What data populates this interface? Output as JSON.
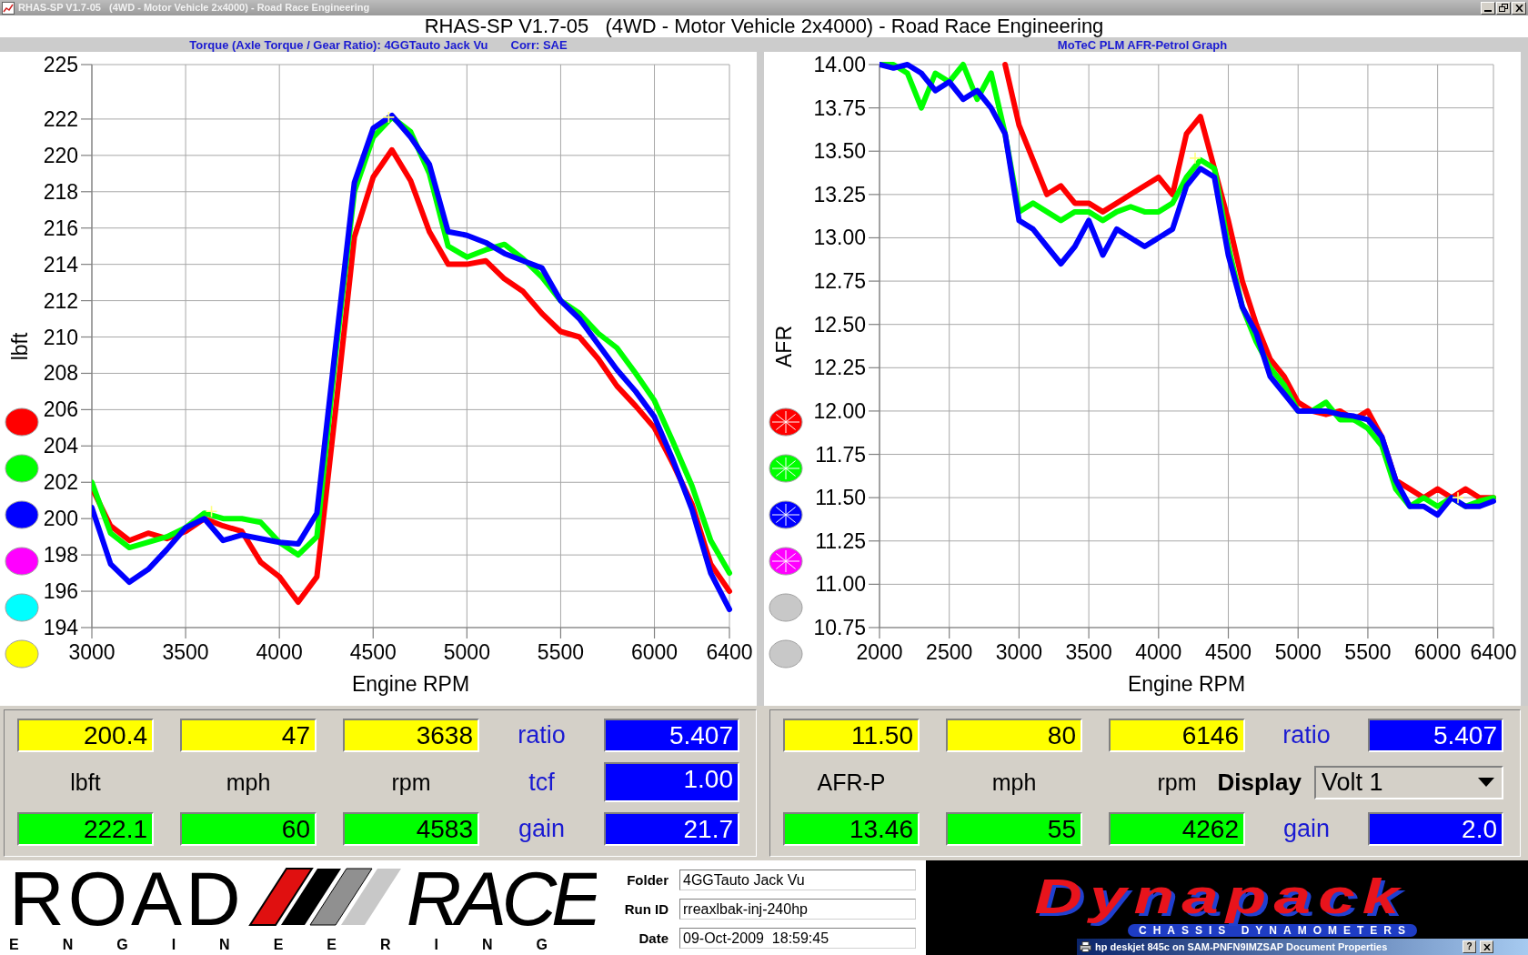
{
  "window": {
    "title": "RHAS-SP V1.7-05   (4WD - Motor Vehicle 2x4000) - Road Race Engineering"
  },
  "header": {
    "title": "RHAS-SP V1.7-05   (4WD - Motor Vehicle 2x4000) - Road Race Engineering"
  },
  "charts": [
    {
      "headings": [
        "Torque (Axle Torque / Gear Ratio): 4GGTauto Jack Vu",
        "Corr: SAE"
      ],
      "legend": [
        {
          "color": "#ff0000",
          "kind": "plain"
        },
        {
          "color": "#00ff00",
          "kind": "plain"
        },
        {
          "color": "#0000ff",
          "kind": "plain"
        },
        {
          "color": "#ff00ff",
          "kind": "plain"
        },
        {
          "color": "#00ffff",
          "kind": "plain"
        },
        {
          "color": "#ffff00",
          "kind": "plain"
        }
      ],
      "chart_data": {
        "type": "line",
        "xlabel": "Engine RPM",
        "ylabel": "lbft",
        "x": [
          3000,
          3100,
          3200,
          3300,
          3400,
          3500,
          3600,
          3700,
          3800,
          3900,
          4000,
          4100,
          4200,
          4300,
          4400,
          4500,
          4600,
          4700,
          4800,
          4900,
          5000,
          5100,
          5200,
          5300,
          5400,
          5500,
          5600,
          5700,
          5800,
          5900,
          6000,
          6100,
          6200,
          6300,
          6400
        ],
        "series": [
          {
            "color": "#ff0000",
            "values": [
              201.7,
              199.6,
              198.8,
              199.2,
              198.9,
              199.3,
              200.0,
              199.6,
              199.3,
              197.6,
              196.8,
              195.4,
              196.8,
              206.0,
              215.5,
              218.8,
              220.3,
              218.6,
              215.8,
              214.0,
              214.0,
              214.2,
              213.2,
              212.5,
              211.3,
              210.3,
              210.0,
              208.8,
              207.3,
              206.2,
              205.0,
              203.0,
              200.8,
              197.5,
              196.0
            ]
          },
          {
            "color": "#00ff00",
            "values": [
              202.0,
              199.2,
              198.4,
              198.7,
              199.0,
              199.5,
              200.3,
              200.0,
              200.0,
              199.8,
              198.7,
              198.0,
              199.0,
              209.0,
              218.0,
              221.0,
              222.1,
              221.3,
              219.0,
              215.0,
              214.4,
              214.8,
              215.1,
              214.3,
              213.3,
              212.0,
              211.3,
              210.2,
              209.4,
              208.0,
              206.5,
              204.2,
              201.8,
              198.8,
              197.0
            ]
          },
          {
            "color": "#0000ff",
            "values": [
              200.6,
              197.5,
              196.5,
              197.2,
              198.3,
              199.5,
              200.0,
              198.8,
              199.1,
              198.9,
              198.7,
              198.6,
              200.3,
              209.5,
              218.5,
              221.5,
              222.2,
              221.0,
              219.5,
              215.8,
              215.6,
              215.2,
              214.6,
              214.2,
              213.8,
              212.0,
              211.0,
              209.6,
              208.2,
              207.0,
              205.6,
              203.2,
              200.5,
              197.0,
              195.0
            ]
          }
        ],
        "xlim": [
          3000,
          6400
        ],
        "ylim": [
          194,
          225
        ],
        "xticks": [
          3000,
          3500,
          4000,
          4500,
          5000,
          5500,
          6000,
          6400
        ],
        "yticks": [
          194,
          196,
          198,
          200,
          202,
          204,
          206,
          208,
          210,
          212,
          214,
          216,
          218,
          220,
          222,
          225
        ],
        "grid": true
      }
    },
    {
      "headings": [
        "MoTeC PLM AFR-Petrol Graph"
      ],
      "legend": [
        {
          "color": "#ff0000",
          "kind": "spoked"
        },
        {
          "color": "#00ff00",
          "kind": "spoked"
        },
        {
          "color": "#0000ff",
          "kind": "spoked"
        },
        {
          "color": "#ff00ff",
          "kind": "spoked"
        },
        {
          "color": "#c8c8c8",
          "kind": "plain"
        },
        {
          "color": "#c8c8c8",
          "kind": "plain"
        }
      ],
      "chart_data": {
        "type": "line",
        "xlabel": "Engine RPM",
        "ylabel": "AFR",
        "x": [
          2000,
          2100,
          2200,
          2300,
          2400,
          2500,
          2600,
          2700,
          2800,
          2900,
          3000,
          3100,
          3200,
          3300,
          3400,
          3500,
          3600,
          3700,
          3800,
          3900,
          4000,
          4100,
          4200,
          4300,
          4400,
          4500,
          4600,
          4700,
          4800,
          4900,
          5000,
          5100,
          5200,
          5300,
          5400,
          5500,
          5600,
          5700,
          5800,
          5900,
          6000,
          6100,
          6200,
          6300,
          6400
        ],
        "series": [
          {
            "color": "#ff0000",
            "values": [
              null,
              null,
              null,
              null,
              null,
              null,
              null,
              null,
              null,
              14.0,
              13.65,
              13.45,
              13.25,
              13.3,
              13.2,
              13.2,
              13.15,
              13.2,
              13.25,
              13.3,
              13.35,
              13.25,
              13.6,
              13.7,
              13.4,
              13.1,
              12.75,
              12.5,
              12.3,
              12.2,
              12.05,
              12.0,
              11.98,
              12.0,
              11.95,
              12.0,
              11.85,
              11.6,
              11.55,
              11.5,
              11.55,
              11.5,
              11.55,
              11.5,
              11.5
            ]
          },
          {
            "color": "#00ff00",
            "values": [
              14.0,
              14.0,
              13.95,
              13.75,
              13.95,
              13.9,
              14.0,
              13.8,
              13.95,
              13.6,
              13.15,
              13.2,
              13.15,
              13.1,
              13.15,
              13.15,
              13.1,
              13.15,
              13.18,
              13.15,
              13.15,
              13.2,
              13.35,
              13.45,
              13.4,
              12.95,
              12.6,
              12.4,
              12.25,
              12.15,
              12.0,
              12.0,
              12.05,
              11.95,
              11.95,
              11.9,
              11.8,
              11.55,
              11.45,
              11.5,
              11.45,
              11.5,
              11.45,
              11.48,
              11.5
            ]
          },
          {
            "color": "#0000ff",
            "values": [
              14.0,
              13.98,
              14.0,
              13.95,
              13.85,
              13.9,
              13.8,
              13.85,
              13.75,
              13.6,
              13.1,
              13.05,
              12.95,
              12.85,
              12.95,
              13.1,
              12.9,
              13.05,
              13.0,
              12.95,
              13.0,
              13.05,
              13.3,
              13.4,
              13.35,
              12.9,
              12.6,
              12.45,
              12.2,
              12.1,
              12.0,
              12.0,
              12.0,
              11.98,
              11.97,
              11.95,
              11.85,
              11.6,
              11.45,
              11.45,
              11.4,
              11.5,
              11.45,
              11.45,
              11.48
            ]
          }
        ],
        "xlim": [
          2000,
          6400
        ],
        "ylim": [
          10.75,
          14.0
        ],
        "xticks": [
          2000,
          2500,
          3000,
          3500,
          4000,
          4500,
          5000,
          5500,
          6000,
          6400
        ],
        "yticks": [
          {
            "value": 10.75,
            "label": "10.75"
          },
          {
            "value": 11.0,
            "label": "11.00"
          },
          {
            "value": 11.25,
            "label": "11.25"
          },
          {
            "value": 11.5,
            "label": "11.50"
          },
          {
            "value": 11.75,
            "label": "11.75"
          },
          {
            "value": 12.0,
            "label": "12.00"
          },
          {
            "value": 12.25,
            "label": "12.25"
          },
          {
            "value": 12.5,
            "label": "12.50"
          },
          {
            "value": 12.75,
            "label": "12.75"
          },
          {
            "value": 13.0,
            "label": "13.00"
          },
          {
            "value": 13.25,
            "label": "13.25"
          },
          {
            "value": 13.5,
            "label": "13.50"
          },
          {
            "value": 13.75,
            "label": "13.75"
          },
          {
            "value": 14.0,
            "label": "14.00"
          }
        ],
        "grid": true
      }
    }
  ],
  "readout_panels": [
    {
      "top_values": [
        "200.4",
        "47",
        "3638"
      ],
      "units": [
        "lbft",
        "mph",
        "rpm"
      ],
      "bottom_values": [
        "222.1",
        "60",
        "4583"
      ],
      "params": [
        {
          "kind": "field",
          "label": "ratio",
          "value": "5.407"
        },
        {
          "kind": "field",
          "label": "tcf",
          "value": "1.00"
        },
        {
          "kind": "field",
          "label": "gain",
          "value": "21.7"
        }
      ]
    },
    {
      "top_values": [
        "11.50",
        "80",
        "6146"
      ],
      "units": [
        "AFR-P",
        "mph",
        "rpm"
      ],
      "bottom_values": [
        "13.46",
        "55",
        "4262"
      ],
      "params": [
        {
          "kind": "field",
          "label": "ratio",
          "value": "5.407"
        },
        {
          "kind": "dropdown",
          "label": "Display",
          "value": "Volt 1"
        },
        {
          "kind": "field",
          "label": "gain",
          "value": "2.0"
        }
      ]
    }
  ],
  "run_info": {
    "logo": {
      "word_1": "ROAD",
      "word_2": "RACE",
      "tagline": "ENGINEERING"
    },
    "fields": [
      {
        "label": "Folder",
        "value": "4GGTauto Jack Vu"
      },
      {
        "label": "Run ID",
        "value": "rreaxlbak-inj-240hp"
      },
      {
        "label": "Date",
        "value": "09-Oct-2009  18:59:45"
      }
    ]
  },
  "sponsor_logo": {
    "name": "Dynapack",
    "tagline": "CHASSIS DYNAMOMETERS"
  },
  "background_window": {
    "title": "hp deskjet 845c on SAM-PNFN9IMZSAP Document Properties",
    "help_button": "?"
  }
}
